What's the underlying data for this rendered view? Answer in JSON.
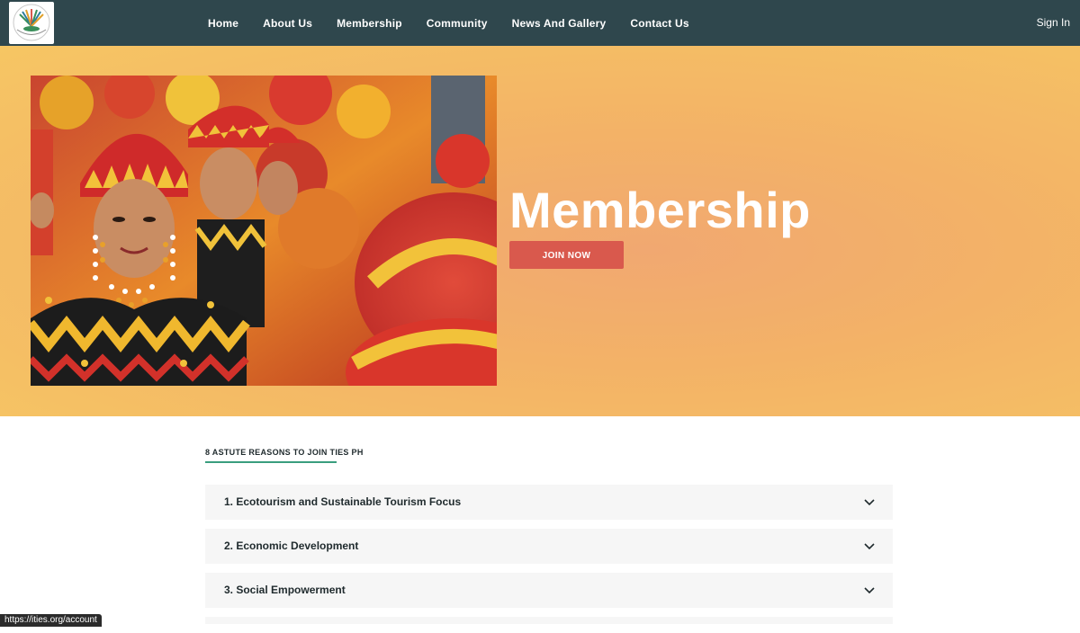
{
  "nav": {
    "items": [
      {
        "label": "Home"
      },
      {
        "label": "About Us"
      },
      {
        "label": "Membership"
      },
      {
        "label": "Community"
      },
      {
        "label": "News And Gallery"
      },
      {
        "label": "Contact Us"
      }
    ],
    "signin": "Sign In"
  },
  "hero": {
    "title": "Membership",
    "join_button": "JOIN NOW"
  },
  "reasons": {
    "heading": "8 ASTUTE REASONS TO JOIN TIES PH",
    "items": [
      {
        "label": "1. Ecotourism and Sustainable Tourism Focus"
      },
      {
        "label": "2. Economic Development"
      },
      {
        "label": "3. Social Empowerment"
      }
    ]
  },
  "status_bar": {
    "url": "https://ities.org/account"
  },
  "colors": {
    "nav_bg": "#2f474d",
    "hero_bg": "#f3b267",
    "join_button": "#d9594d",
    "underline_accent": "#3a9e7e"
  },
  "icons": [
    "logo-icon",
    "chevron-down-icon"
  ]
}
